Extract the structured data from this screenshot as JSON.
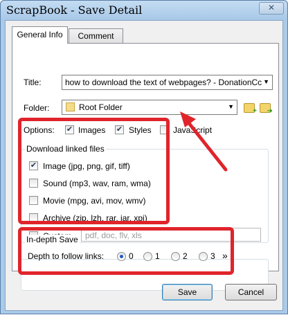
{
  "window": {
    "title": "ScrapBook - Save Detail",
    "close_glyph": "✕"
  },
  "tabs": [
    {
      "label": "General Info",
      "selected": true
    },
    {
      "label": "Comment",
      "selected": false
    }
  ],
  "general": {
    "title_label": "Title:",
    "title_value": "how to download the text of webpages? - DonationCc",
    "folder_label": "Folder:",
    "folder_value": "Root Folder",
    "options_label": "Options:",
    "options": [
      {
        "label": "Images",
        "checked": true
      },
      {
        "label": "Styles",
        "checked": true
      },
      {
        "label": "JavaScript",
        "checked": false
      }
    ]
  },
  "download_linked": {
    "caption": "Download linked files",
    "items": [
      {
        "label": "Image (jpg, png, gif, tiff)",
        "checked": true
      },
      {
        "label": "Sound (mp3, wav, ram, wma)",
        "checked": false
      },
      {
        "label": "Movie (mpg, avi, mov, wmv)",
        "checked": false
      },
      {
        "label": "Archive (zip, lzh, rar, jar, xpi)",
        "checked": false
      },
      {
        "label": "Custom",
        "checked": false
      }
    ],
    "custom_placeholder": "pdf, doc, flv, xls"
  },
  "in_depth": {
    "caption": "In-depth Save",
    "depth_label": "Depth to follow links:",
    "depths": [
      "0",
      "1",
      "2",
      "3"
    ],
    "selected": "0",
    "more": "»"
  },
  "buttons": {
    "save": "Save",
    "cancel": "Cancel"
  },
  "colors": {
    "annotation_red": "#e0242b",
    "titlebar": "#a9cae9"
  },
  "icons": {
    "folder_add": "folder-add-icon",
    "folder_go": "folder-go-icon",
    "check": "✔"
  }
}
